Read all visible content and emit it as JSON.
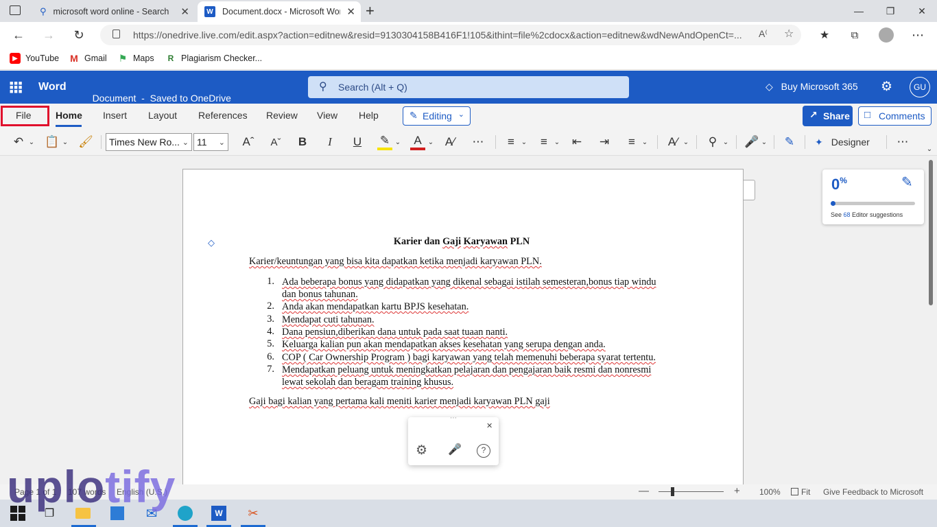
{
  "browser": {
    "tabs": [
      {
        "title": "microsoft word online - Search",
        "active": false
      },
      {
        "title": "Document.docx - Microsoft Word",
        "active": true
      }
    ],
    "url": "https://onedrive.live.com/edit.aspx?action=editnew&resid=9130304158B416F1!105&ithint=file%2cdocx&action=editnew&wdNewAndOpenCt=...",
    "bookmarks": [
      {
        "label": "YouTube",
        "color": "#ff0000"
      },
      {
        "label": "Gmail",
        "color": "#d93025"
      },
      {
        "label": "Maps",
        "color": "#34a853"
      },
      {
        "label": "Plagiarism Checker...",
        "color": "#2e7d32"
      }
    ]
  },
  "word": {
    "app_name": "Word",
    "doc_status": "Document  -  Saved to OneDrive",
    "search_placeholder": "Search (Alt + Q)",
    "buy_label": "Buy Microsoft 365",
    "avatar_initials": "GU",
    "accent": "#1d5bc4"
  },
  "ribbon": {
    "tabs": [
      "File",
      "Home",
      "Insert",
      "Layout",
      "References",
      "Review",
      "View",
      "Help"
    ],
    "active_tab": "Home",
    "editing_label": "Editing",
    "share_label": "Share",
    "comments_label": "Comments",
    "font_name": "Times New Ro...",
    "font_size": "11",
    "designer_label": "Designer"
  },
  "document": {
    "title_parts": [
      "Karier dan ",
      "Gaji",
      " ",
      "Karyawan",
      " PLN"
    ],
    "intro": "Karier/keuntungan yang bisa kita dapatkan ketika menjadi karyawan PLN.",
    "items": [
      {
        "num": "1.",
        "line1": "Ada beberapa bonus yang didapatkan yang dikenal sebagai istilah semesteran,bonus tiap windu",
        "line2": "dan bonus tahunan."
      },
      {
        "num": "2.",
        "line1": "Anda akan mendapatkan kartu BPJS kesehatan."
      },
      {
        "num": "3.",
        "line1": "Mendapat cuti tahunan."
      },
      {
        "num": "4.",
        "line1": "Dana pensiun,diberikan dana untuk pada saat tuaan nanti."
      },
      {
        "num": "5.",
        "line1": "Keluarga kalian pun akan mendapatkan akses kesehatan yang serupa dengan anda."
      },
      {
        "num": "6.",
        "line1": "COP ( Car Ownership Program ) bagi karyawan yang telah memenuhi beberapa syarat tertentu."
      },
      {
        "num": "7.",
        "line1": "Mendapatkan peluang untuk meningkatkan pelajaran dan pengajaran baik resmi dan nonresmi",
        "line2": "lewat sekolah dan beragam training khusus."
      }
    ],
    "closing": "Gaji bagi kalian yang pertama kali meniti karier menjadi karyawan PLN gaji"
  },
  "editor": {
    "score": "0",
    "score_unit": "%",
    "progress_fraction": 0.0,
    "see_prefix": "See ",
    "count": "68",
    "suffix": " Editor suggestions"
  },
  "status": {
    "page": "Page 1 of 1",
    "words": "107 words",
    "language": "English (U.S.)",
    "zoom": "100%",
    "fit": "Fit",
    "feedback": "Give Feedback to Microsoft"
  },
  "watermark": {
    "text_a": "uplo",
    "text_b": "tify"
  }
}
